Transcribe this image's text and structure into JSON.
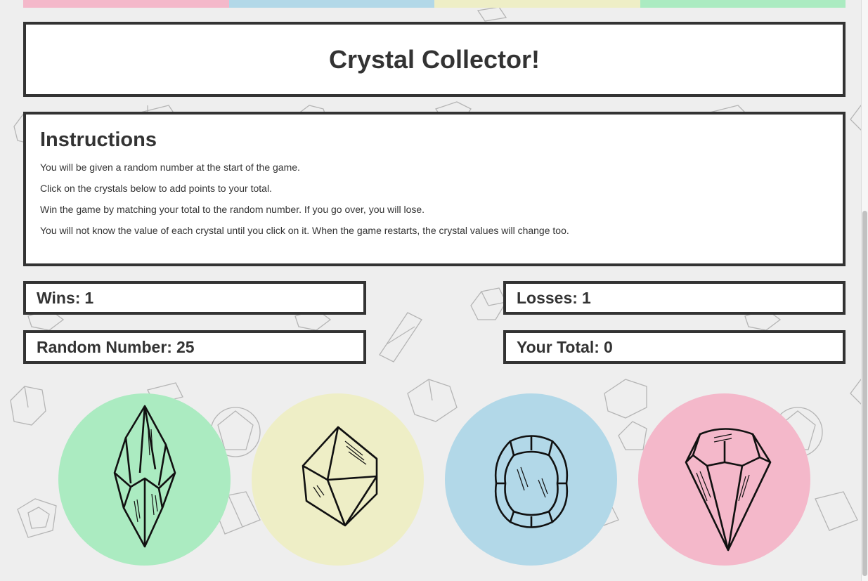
{
  "colors": {
    "green": "#abebc1",
    "yellow": "#eeeec6",
    "blue": "#b2d8e8",
    "pink": "#f4b8ca",
    "border": "#333333",
    "background": "#eeeeee"
  },
  "header": {
    "title": "Crystal Collector!"
  },
  "instructions": {
    "heading": "Instructions",
    "lines": [
      "You will be given a random number at the start of the game.",
      "Click on the crystals below to add points to your total.",
      "Win the game by matching your total to the random number. If you go over, you will lose.",
      "You will not know the value of each crystal until you click on it. When the game restarts, the crystal values will change too."
    ]
  },
  "stats": {
    "wins_label": "Wins:",
    "wins": "1",
    "losses_label": "Losses:",
    "losses": "1",
    "random_label": "Random Number:",
    "random": "25",
    "total_label": "Your Total:",
    "total": "0"
  },
  "crystals": [
    {
      "icon": "long-crystal-icon",
      "color": "green"
    },
    {
      "icon": "octahedron-crystal-icon",
      "color": "yellow"
    },
    {
      "icon": "cushion-gem-icon",
      "color": "blue"
    },
    {
      "icon": "diamond-gem-icon",
      "color": "pink"
    }
  ]
}
